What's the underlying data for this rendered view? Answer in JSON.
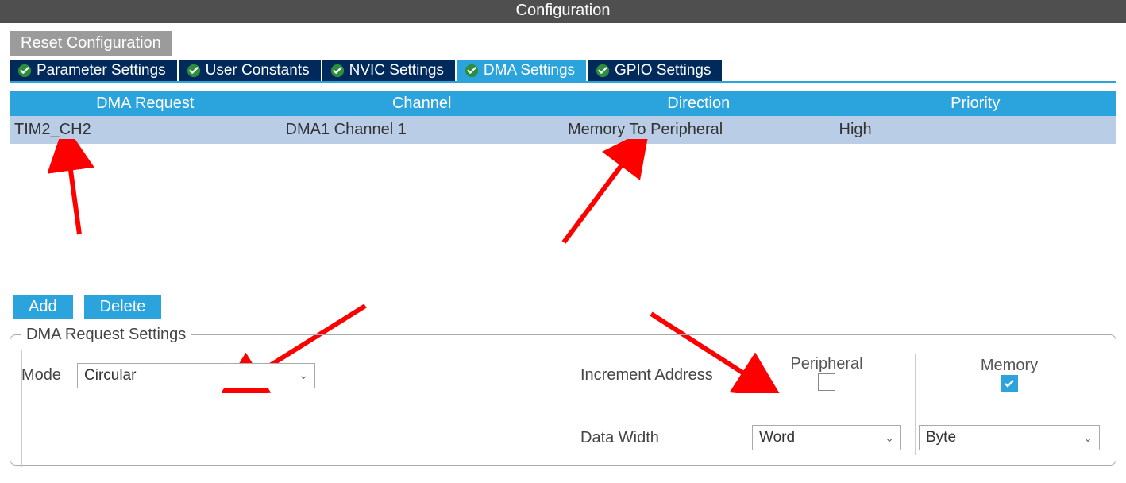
{
  "title": "Configuration",
  "buttons": {
    "reset": "Reset Configuration",
    "add": "Add",
    "delete": "Delete"
  },
  "tabs": [
    {
      "label": "Parameter Settings",
      "active": false
    },
    {
      "label": "User Constants",
      "active": false
    },
    {
      "label": "NVIC Settings",
      "active": false
    },
    {
      "label": "DMA Settings",
      "active": true
    },
    {
      "label": "GPIO Settings",
      "active": false
    }
  ],
  "table": {
    "headers": [
      "DMA Request",
      "Channel",
      "Direction",
      "Priority"
    ],
    "rows": [
      {
        "request": "TIM2_CH2",
        "channel": "DMA1 Channel 1",
        "direction": "Memory To Peripheral",
        "priority": "High"
      }
    ]
  },
  "settings": {
    "legend": "DMA Request Settings",
    "mode_label": "Mode",
    "mode_value": "Circular",
    "col_peripheral": "Peripheral",
    "col_memory": "Memory",
    "increment_label": "Increment Address",
    "increment_peripheral_checked": false,
    "increment_memory_checked": true,
    "datawidth_label": "Data Width",
    "datawidth_peripheral": "Word",
    "datawidth_memory": "Byte"
  }
}
